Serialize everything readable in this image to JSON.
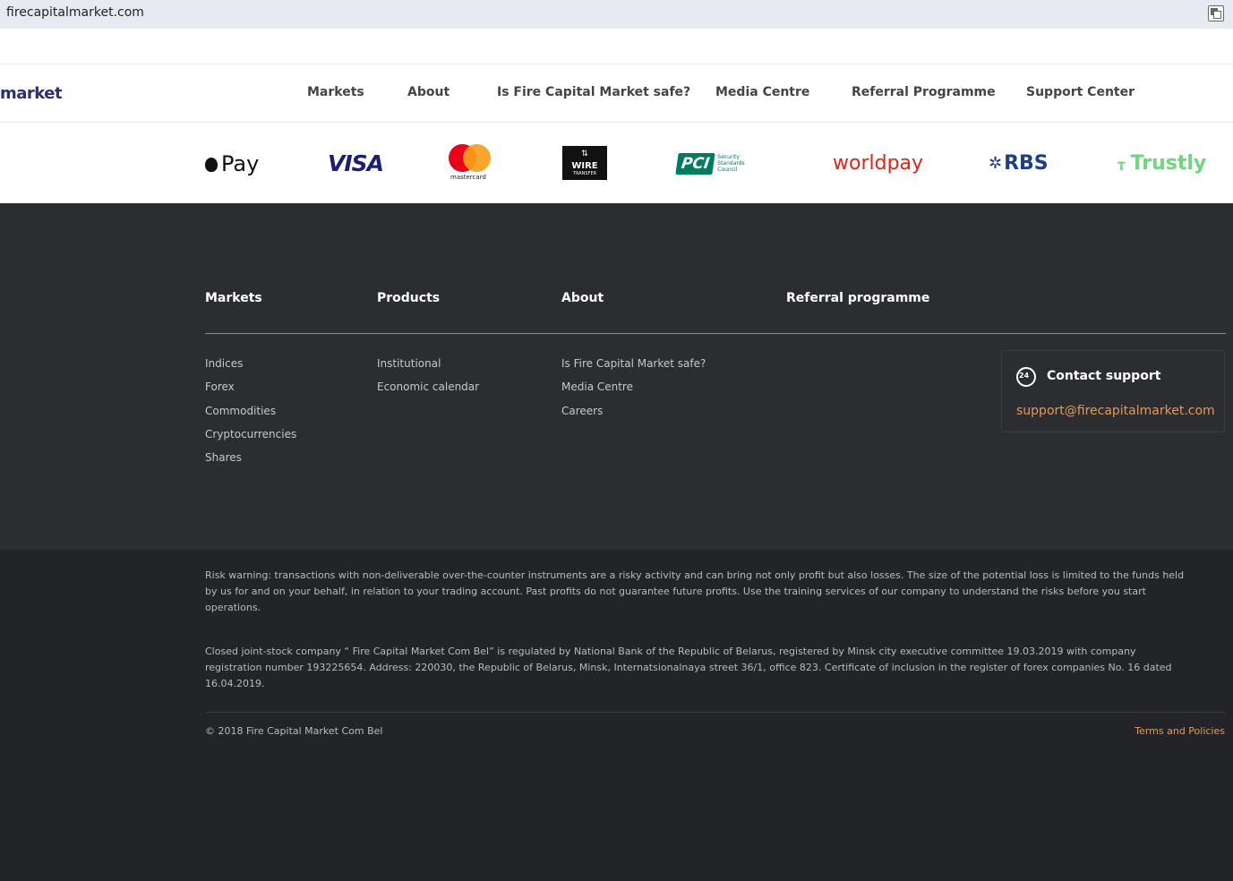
{
  "browser": {
    "url": "firecapitalmarket.com",
    "translate_icon": "translate-icon"
  },
  "header": {
    "logo_text": "market",
    "nav": [
      "Markets",
      "About",
      "Is Fire Capital Market safe?",
      "Media Centre",
      "Referral Programme",
      "Support Center"
    ]
  },
  "payments": {
    "applepay": "Pay",
    "visa": "VISA",
    "mastercard": "mastercard",
    "wire": [
      "⇅",
      "WIRE",
      "TRANSFER"
    ],
    "pci": {
      "mark": "PCI",
      "sub": "Security Standards Council"
    },
    "worldpay": "worldpay",
    "rbs": "RBS",
    "trustly": "Trustly"
  },
  "footer": {
    "columns": [
      {
        "heading": "Markets",
        "links": [
          "Indices",
          "Forex",
          "Commodities",
          "Cryptocurrencies",
          "Shares"
        ]
      },
      {
        "heading": "Products",
        "links": [
          "Institutional",
          "Economic calendar"
        ]
      },
      {
        "heading": "About",
        "links": [
          "Is Fire Capital Market safe?",
          "Media Centre",
          "Careers"
        ]
      },
      {
        "heading": "Referral programme",
        "links": []
      }
    ],
    "contact": {
      "icon": "phone-24-icon",
      "badge": "24",
      "title": "Contact support",
      "email": "support@firecapitalmarket.com"
    }
  },
  "legal": {
    "risk_warning": "Risk warning: transactions with non-deliverable over-the-counter instruments are a risky activity and can bring not only profit but also losses. The size of the potential loss is limited to the funds held by us for and on your behalf, in relation to your trading account. Past profits do not guarantee future profits. Use the training services of our company to understand the risks before you start operations.",
    "registration": "Closed joint-stock company “ Fire Capital Market Com Bel” is regulated by National Bank of the Republic of Belarus, registered by Minsk city executive committee 19.03.2019 with company registration number 193225654. Address: 220030, the Republic of Belarus, Minsk, Internatsionalnaya street 36/1, office 823. Certificate of inclusion in the register of forex companies No. 16 dated 16.04.2019.",
    "copyright": "© 2018 Fire Capital Market Com Bel",
    "terms": "Terms and Policies"
  },
  "colors": {
    "footer_bg": "#2c2d31",
    "legal_bg": "#232428",
    "accent_link": "#e09a5c",
    "logo": "#2b2f6e"
  }
}
